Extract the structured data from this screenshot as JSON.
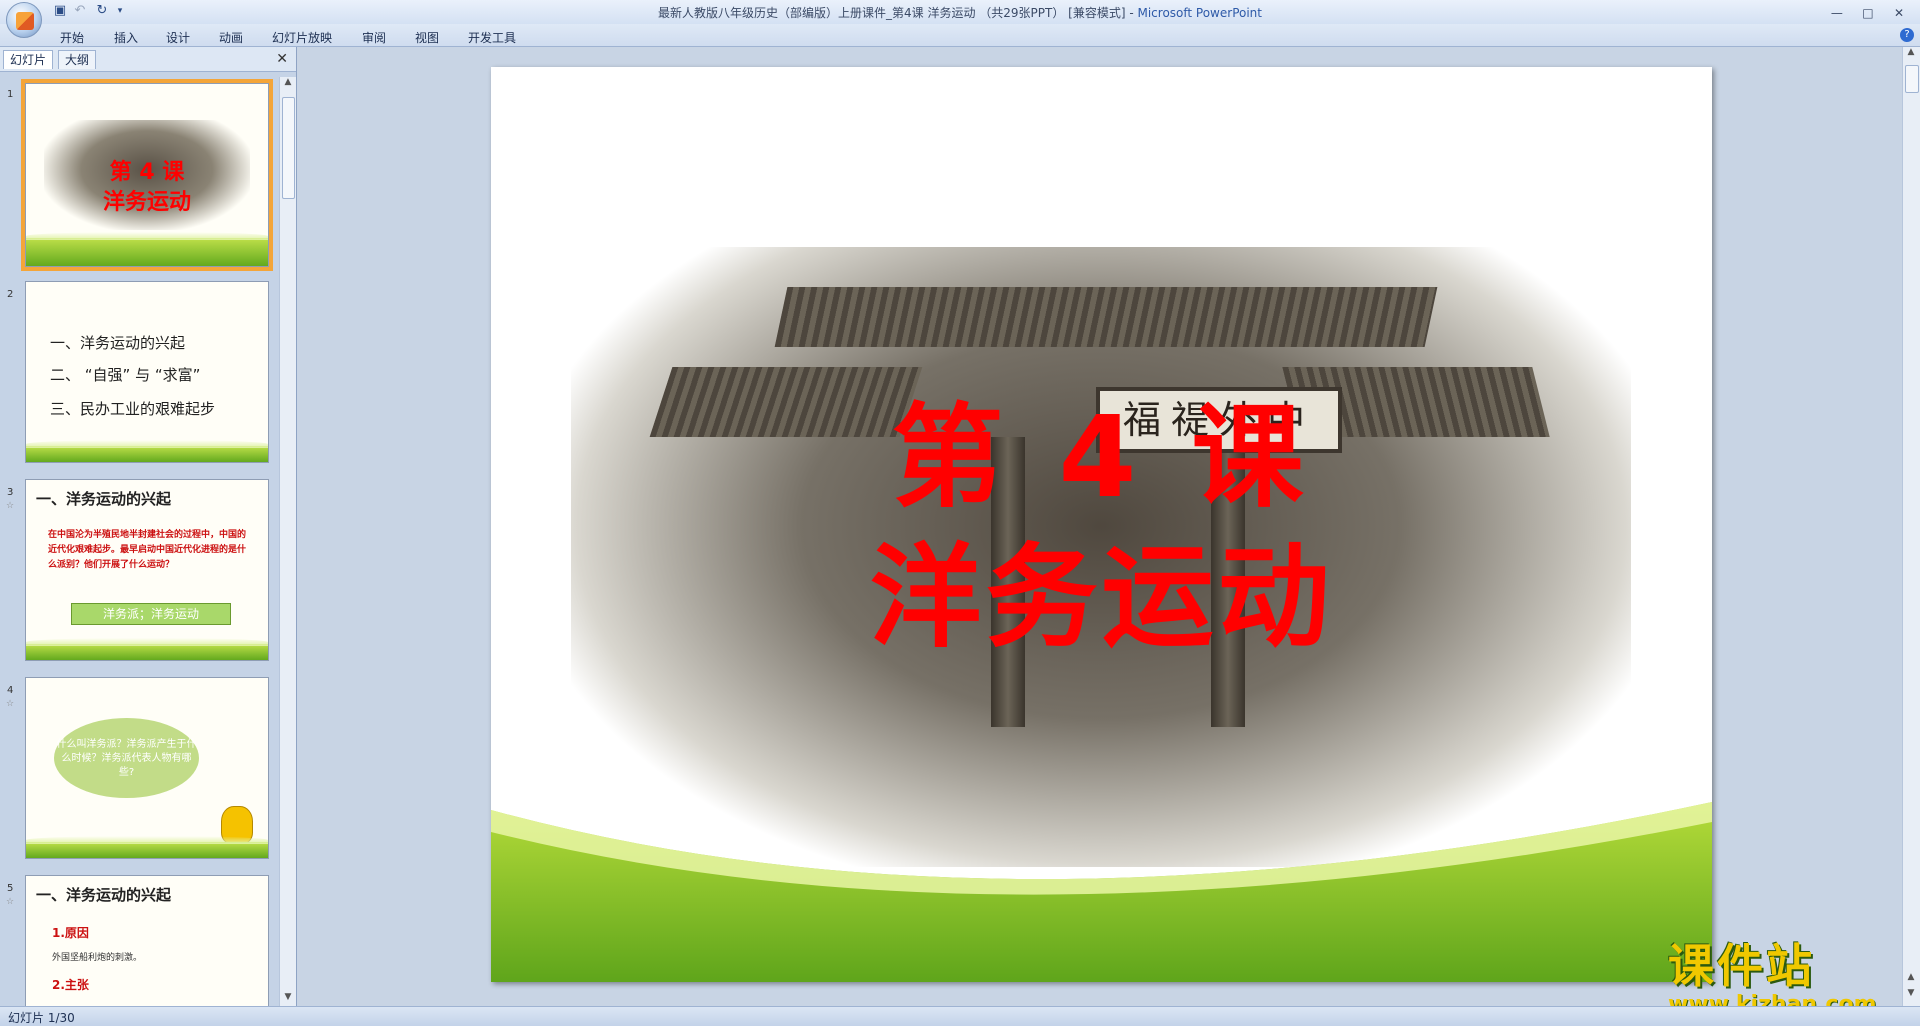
{
  "window": {
    "title_main": "最新人教版八年级历史（部编版）上册课件_第4课  洋务运动 （共29张PPT） [兼容模式] - ",
    "title_app": "Microsoft PowerPoint"
  },
  "ribbon": {
    "tabs": [
      "开始",
      "插入",
      "设计",
      "动画",
      "幻灯片放映",
      "审阅",
      "视图",
      "开发工具"
    ]
  },
  "left_pane": {
    "tabs": [
      "幻灯片",
      "大纲"
    ],
    "close": "✕"
  },
  "thumbnails": [
    {
      "num": "1",
      "title_line1": "第 4 课",
      "title_line2": "洋务运动"
    },
    {
      "num": "2",
      "lines": [
        "一、洋务运动的兴起",
        "二、 “自强” 与 “求富”",
        "三、民办工业的艰难起步"
      ]
    },
    {
      "num": "3",
      "heading": "一、洋务运动的兴起",
      "red_text": "在中国沦为半殖民地半封建社会的过程中，中国的近代化艰难起步。最早启动中国近代化进程的是什么派别？他们开展了什么运动？",
      "box": "洋务派；洋务运动"
    },
    {
      "num": "4",
      "cloud": "什么叫洋务派？洋务派产生于什么时候？洋务派代表人物有哪些?"
    },
    {
      "num": "5",
      "heading": "一、洋务运动的兴起",
      "sub1": "1.原因",
      "sub1_text": "外国坚船利炮的刺激。",
      "sub2": "2.主张"
    }
  ],
  "slide": {
    "sign_text": "福禔外中",
    "title_line1": "第 4 课",
    "title_line2": "洋务运动"
  },
  "watermark": {
    "big": "课件站",
    "url": "www.kjzhan.com"
  },
  "status": {
    "slide_indicator": "幻灯片 1/30"
  },
  "colors": {
    "title_red": "#ff0000",
    "selection_orange": "#f4a539",
    "green_band": "#63a91e"
  }
}
